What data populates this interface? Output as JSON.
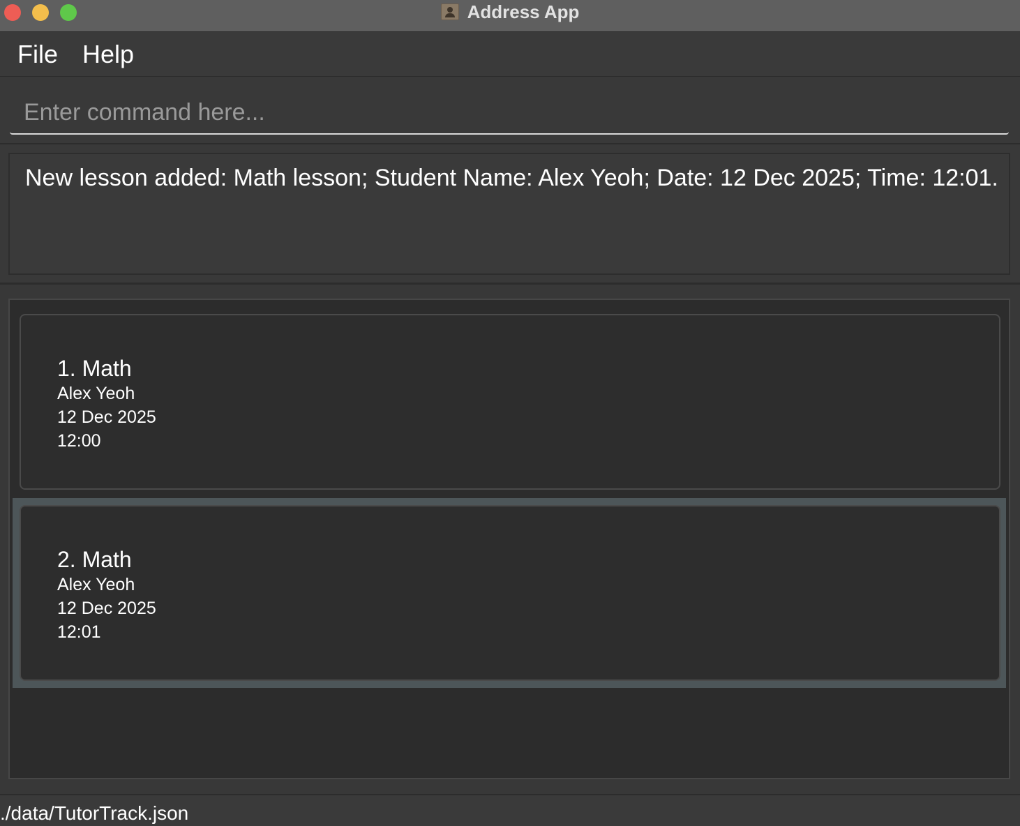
{
  "window": {
    "title": "Address App"
  },
  "menu": {
    "file": "File",
    "help": "Help"
  },
  "command": {
    "placeholder": "Enter command here...",
    "value": ""
  },
  "result": {
    "message": "New lesson added: Math lesson; Student Name: Alex Yeoh; Date: 12 Dec 2025; Time: 12:01."
  },
  "lessons": [
    {
      "title": "1. Math",
      "student": "Alex Yeoh",
      "date": "12 Dec 2025",
      "time": "12:00",
      "selected": false
    },
    {
      "title": "2. Math",
      "student": "Alex Yeoh",
      "date": "12 Dec 2025",
      "time": "12:01",
      "selected": true
    }
  ],
  "status": {
    "file_path": "./data/TutorTrack.json"
  },
  "colors": {
    "close": "#ee5d55",
    "minimize": "#f3be4c",
    "maximize": "#5fc84a",
    "selected_row": "#4d5659"
  }
}
